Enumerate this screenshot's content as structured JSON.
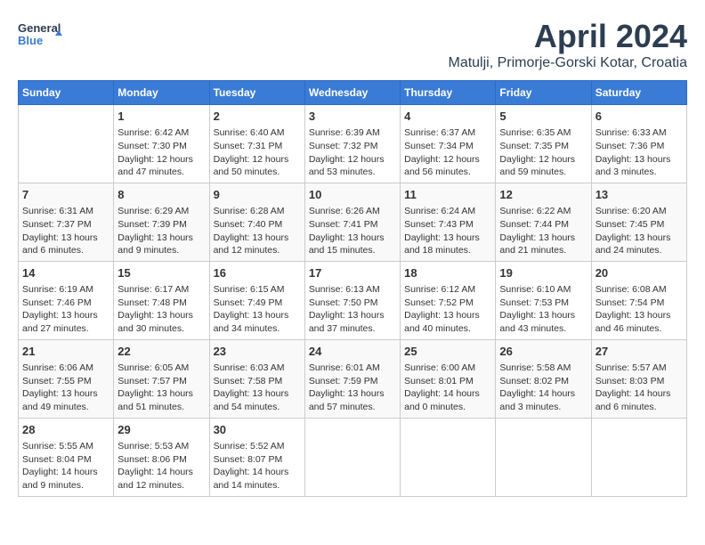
{
  "logo": {
    "text_general": "General",
    "text_blue": "Blue"
  },
  "title": "April 2024",
  "subtitle": "Matulji, Primorje-Gorski Kotar, Croatia",
  "days_of_week": [
    "Sunday",
    "Monday",
    "Tuesday",
    "Wednesday",
    "Thursday",
    "Friday",
    "Saturday"
  ],
  "weeks": [
    [
      {
        "day": "",
        "info": ""
      },
      {
        "day": "1",
        "info": "Sunrise: 6:42 AM\nSunset: 7:30 PM\nDaylight: 12 hours\nand 47 minutes."
      },
      {
        "day": "2",
        "info": "Sunrise: 6:40 AM\nSunset: 7:31 PM\nDaylight: 12 hours\nand 50 minutes."
      },
      {
        "day": "3",
        "info": "Sunrise: 6:39 AM\nSunset: 7:32 PM\nDaylight: 12 hours\nand 53 minutes."
      },
      {
        "day": "4",
        "info": "Sunrise: 6:37 AM\nSunset: 7:34 PM\nDaylight: 12 hours\nand 56 minutes."
      },
      {
        "day": "5",
        "info": "Sunrise: 6:35 AM\nSunset: 7:35 PM\nDaylight: 12 hours\nand 59 minutes."
      },
      {
        "day": "6",
        "info": "Sunrise: 6:33 AM\nSunset: 7:36 PM\nDaylight: 13 hours\nand 3 minutes."
      }
    ],
    [
      {
        "day": "7",
        "info": "Sunrise: 6:31 AM\nSunset: 7:37 PM\nDaylight: 13 hours\nand 6 minutes."
      },
      {
        "day": "8",
        "info": "Sunrise: 6:29 AM\nSunset: 7:39 PM\nDaylight: 13 hours\nand 9 minutes."
      },
      {
        "day": "9",
        "info": "Sunrise: 6:28 AM\nSunset: 7:40 PM\nDaylight: 13 hours\nand 12 minutes."
      },
      {
        "day": "10",
        "info": "Sunrise: 6:26 AM\nSunset: 7:41 PM\nDaylight: 13 hours\nand 15 minutes."
      },
      {
        "day": "11",
        "info": "Sunrise: 6:24 AM\nSunset: 7:43 PM\nDaylight: 13 hours\nand 18 minutes."
      },
      {
        "day": "12",
        "info": "Sunrise: 6:22 AM\nSunset: 7:44 PM\nDaylight: 13 hours\nand 21 minutes."
      },
      {
        "day": "13",
        "info": "Sunrise: 6:20 AM\nSunset: 7:45 PM\nDaylight: 13 hours\nand 24 minutes."
      }
    ],
    [
      {
        "day": "14",
        "info": "Sunrise: 6:19 AM\nSunset: 7:46 PM\nDaylight: 13 hours\nand 27 minutes."
      },
      {
        "day": "15",
        "info": "Sunrise: 6:17 AM\nSunset: 7:48 PM\nDaylight: 13 hours\nand 30 minutes."
      },
      {
        "day": "16",
        "info": "Sunrise: 6:15 AM\nSunset: 7:49 PM\nDaylight: 13 hours\nand 34 minutes."
      },
      {
        "day": "17",
        "info": "Sunrise: 6:13 AM\nSunset: 7:50 PM\nDaylight: 13 hours\nand 37 minutes."
      },
      {
        "day": "18",
        "info": "Sunrise: 6:12 AM\nSunset: 7:52 PM\nDaylight: 13 hours\nand 40 minutes."
      },
      {
        "day": "19",
        "info": "Sunrise: 6:10 AM\nSunset: 7:53 PM\nDaylight: 13 hours\nand 43 minutes."
      },
      {
        "day": "20",
        "info": "Sunrise: 6:08 AM\nSunset: 7:54 PM\nDaylight: 13 hours\nand 46 minutes."
      }
    ],
    [
      {
        "day": "21",
        "info": "Sunrise: 6:06 AM\nSunset: 7:55 PM\nDaylight: 13 hours\nand 49 minutes."
      },
      {
        "day": "22",
        "info": "Sunrise: 6:05 AM\nSunset: 7:57 PM\nDaylight: 13 hours\nand 51 minutes."
      },
      {
        "day": "23",
        "info": "Sunrise: 6:03 AM\nSunset: 7:58 PM\nDaylight: 13 hours\nand 54 minutes."
      },
      {
        "day": "24",
        "info": "Sunrise: 6:01 AM\nSunset: 7:59 PM\nDaylight: 13 hours\nand 57 minutes."
      },
      {
        "day": "25",
        "info": "Sunrise: 6:00 AM\nSunset: 8:01 PM\nDaylight: 14 hours\nand 0 minutes."
      },
      {
        "day": "26",
        "info": "Sunrise: 5:58 AM\nSunset: 8:02 PM\nDaylight: 14 hours\nand 3 minutes."
      },
      {
        "day": "27",
        "info": "Sunrise: 5:57 AM\nSunset: 8:03 PM\nDaylight: 14 hours\nand 6 minutes."
      }
    ],
    [
      {
        "day": "28",
        "info": "Sunrise: 5:55 AM\nSunset: 8:04 PM\nDaylight: 14 hours\nand 9 minutes."
      },
      {
        "day": "29",
        "info": "Sunrise: 5:53 AM\nSunset: 8:06 PM\nDaylight: 14 hours\nand 12 minutes."
      },
      {
        "day": "30",
        "info": "Sunrise: 5:52 AM\nSunset: 8:07 PM\nDaylight: 14 hours\nand 14 minutes."
      },
      {
        "day": "",
        "info": ""
      },
      {
        "day": "",
        "info": ""
      },
      {
        "day": "",
        "info": ""
      },
      {
        "day": "",
        "info": ""
      }
    ]
  ]
}
